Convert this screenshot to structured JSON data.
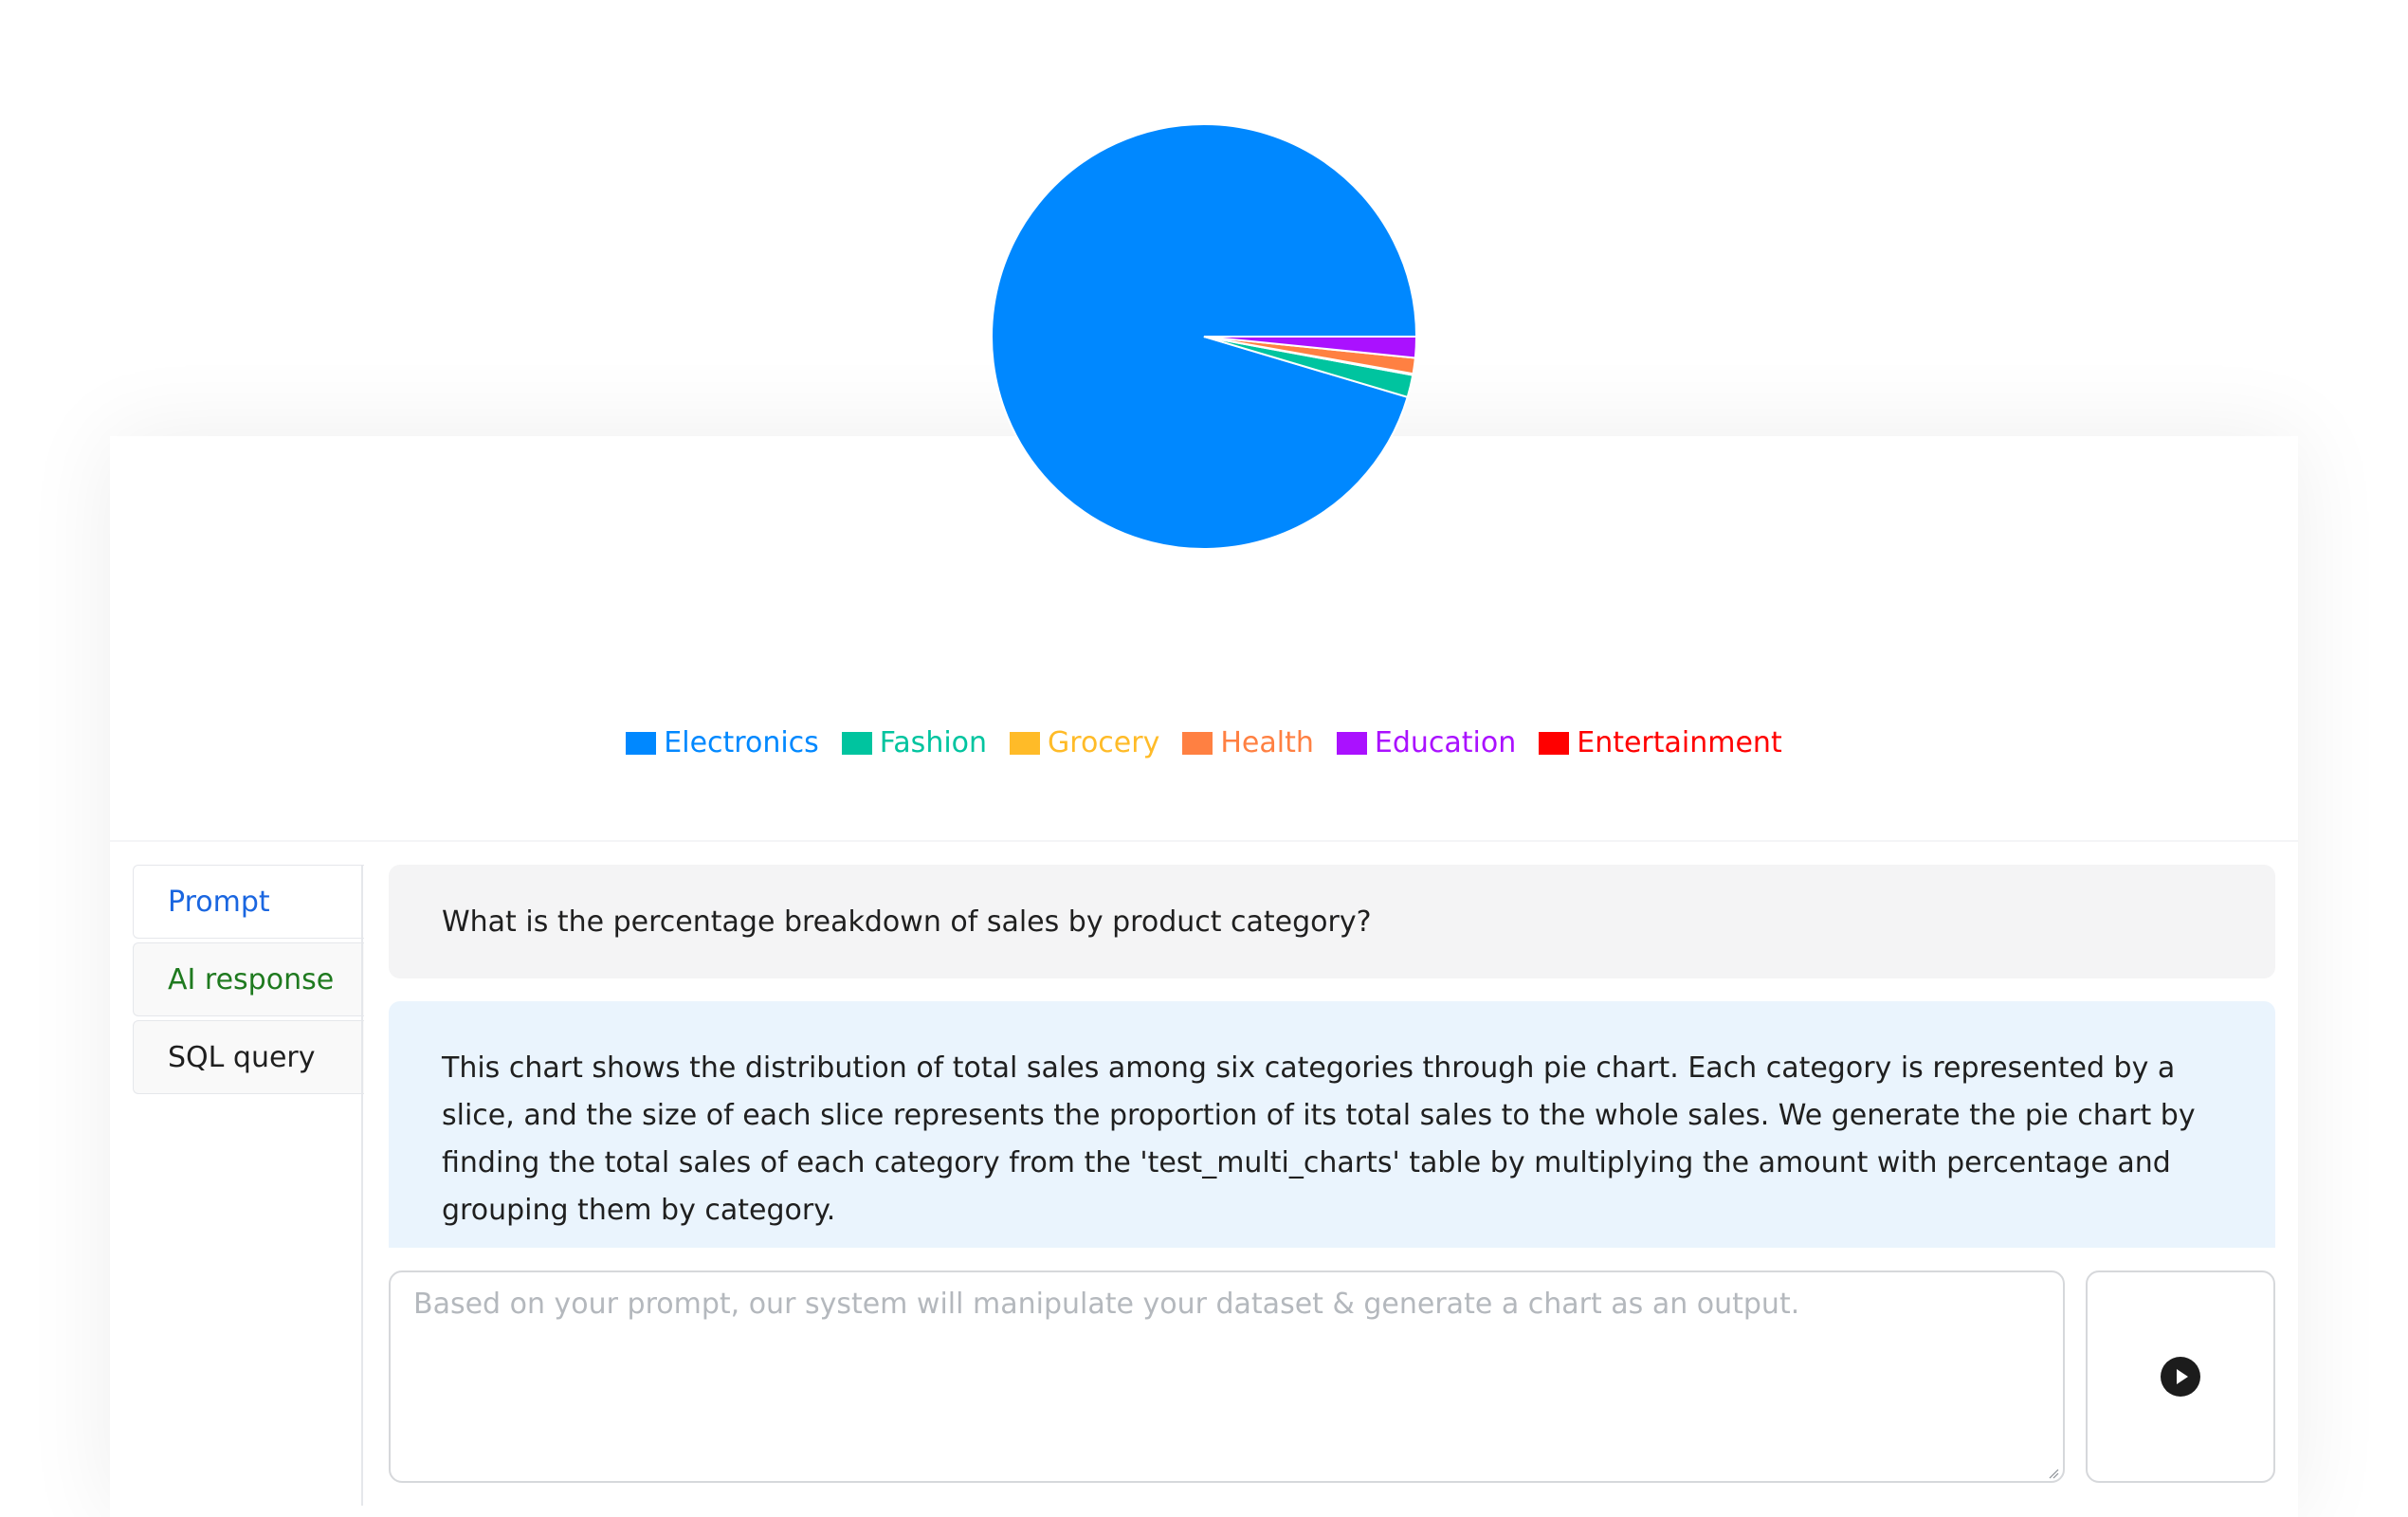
{
  "chart_data": {
    "type": "pie",
    "categories": [
      "Electronics",
      "Fashion",
      "Grocery",
      "Health",
      "Education",
      "Entertainment"
    ],
    "values": [
      95.4,
      1.7,
      0.1,
      1.2,
      1.6,
      0.0
    ],
    "colors": [
      "#0088ff",
      "#00c49f",
      "#ffbb28",
      "#ff8042",
      "#aa11ff",
      "#ff0000"
    ],
    "legend": "bottom",
    "title": ""
  },
  "tabs": [
    {
      "label": "Prompt",
      "color": "#1a66e0"
    },
    {
      "label": "AI response",
      "color": "#1f7a1f"
    },
    {
      "label": "SQL query",
      "color": "#1f1f1f"
    }
  ],
  "prompt": {
    "text": "What is the percentage breakdown of sales by product category?"
  },
  "response": {
    "text": "This chart shows the distribution of total sales among six categories through pie chart. Each category is represented by a slice, and the size of each slice represents the proportion of its total sales to the whole sales. We generate the pie chart by finding the total sales of each category from the 'test_multi_charts' table by multiplying the amount with percentage and grouping them by category."
  },
  "input": {
    "value": "",
    "placeholder": "Based on your prompt, our system will manipulate your dataset & generate a chart as an output."
  },
  "icons": {
    "send": "play-circle-icon"
  }
}
